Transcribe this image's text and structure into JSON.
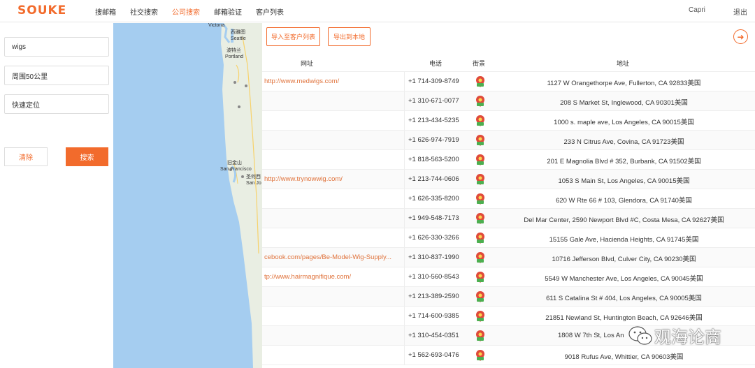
{
  "header": {
    "logo": "SOUKE",
    "nav": [
      {
        "label": "搜邮箱",
        "active": false
      },
      {
        "label": "社交搜索",
        "active": false
      },
      {
        "label": "公司搜索",
        "active": true
      },
      {
        "label": "邮箱验证",
        "active": false
      },
      {
        "label": "客户列表",
        "active": false
      }
    ],
    "user": "Capri",
    "logout": "退出"
  },
  "search": {
    "keyword": "wigs",
    "radius": "周围50公里",
    "locate": "快速定位",
    "clear_label": "清除",
    "search_label": "搜索"
  },
  "map": {
    "labels": [
      "Victoria",
      "西雅图",
      "Seattle",
      "波特兰",
      "Portland",
      "旧金山",
      "San Francisco",
      "圣何西",
      "San Jo"
    ]
  },
  "toolbar": {
    "import_label": "导入至客户列表",
    "export_label": "导出到本地"
  },
  "table": {
    "headers": {
      "url": "网址",
      "phone": "电话",
      "street": "街景",
      "address": "地址"
    },
    "rows": [
      {
        "url": "http://www.medwigs.com/",
        "phone": "+1 714-309-8749",
        "address": "1127 W Orangethorpe Ave, Fullerton, CA 92833美国"
      },
      {
        "url": "",
        "phone": "+1 310-671-0077",
        "address": "208 S Market St, Inglewood, CA 90301美国"
      },
      {
        "url": "",
        "phone": "+1 213-434-5235",
        "address": "1000 s. maple ave, Los Angeles, CA 90015美国"
      },
      {
        "url": "",
        "phone": "+1 626-974-7919",
        "address": "233 N Citrus Ave, Covina, CA 91723美国"
      },
      {
        "url": "",
        "phone": "+1 818-563-5200",
        "address": "201 E Magnolia Blvd # 352, Burbank, CA 91502美国"
      },
      {
        "url": "http://www.trynowwig.com/",
        "phone": "+1 213-744-0606",
        "address": "1053 S Main St, Los Angeles, CA 90015美国"
      },
      {
        "url": "",
        "phone": "+1 626-335-8200",
        "address": "620 W Rte 66 # 103, Glendora, CA 91740美国"
      },
      {
        "url": "",
        "phone": "+1 949-548-7173",
        "address": "Del Mar Center, 2590 Newport Blvd #C, Costa Mesa, CA 92627美国"
      },
      {
        "url": "",
        "phone": "+1 626-330-3266",
        "address": "15155 Gale Ave, Hacienda Heights, CA 91745美国"
      },
      {
        "url": "cebook.com/pages/Be-Model-Wig-Supply...",
        "phone": "+1 310-837-1990",
        "address": "10716 Jefferson Blvd, Culver City, CA 90230美国"
      },
      {
        "url": "tp://www.hairmagnifique.com/",
        "phone": "+1 310-560-8543",
        "address": "5549 W Manchester Ave, Los Angeles, CA 90045美国"
      },
      {
        "url": "",
        "phone": "+1 213-389-2590",
        "address": "611 S Catalina St # 404, Los Angeles, CA 90005美国"
      },
      {
        "url": "",
        "phone": "+1 714-600-9385",
        "address": "21851 Newland St, Huntington Beach, CA 92646美国"
      },
      {
        "url": "",
        "phone": "+1 310-454-0351",
        "address": "1808 W 7th St, Los An"
      },
      {
        "url": "",
        "phone": "+1 562-693-0476",
        "address": "9018 Rufus Ave, Whittier, CA 90603美国"
      }
    ]
  },
  "watermark": "观海论商",
  "colors": {
    "accent": "#f26b2c",
    "link": "#e0733c",
    "water": "#a5cdf0",
    "land": "#e9eee3"
  }
}
